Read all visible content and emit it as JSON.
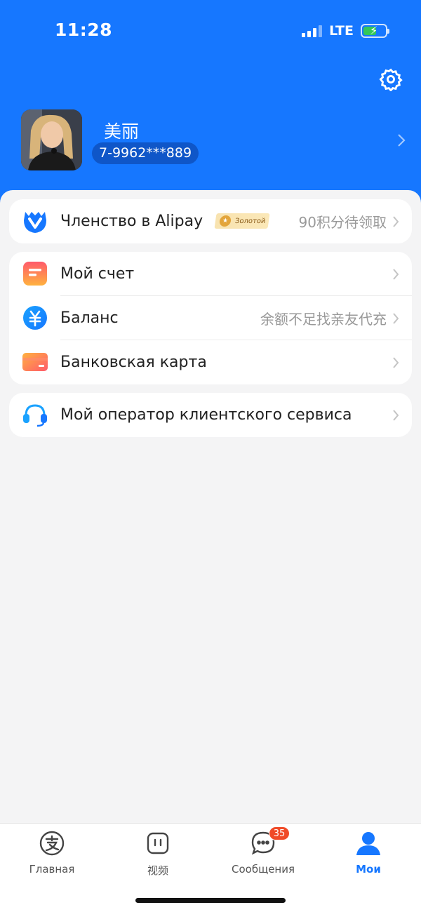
{
  "status_bar": {
    "time": "11:28",
    "network": "LTE"
  },
  "profile": {
    "name": "美丽",
    "phone": "7-9962***889"
  },
  "membership": {
    "label": "Членство в Alipay",
    "badge": "Золотой",
    "value": "90积分待领取"
  },
  "account_card": {
    "items": [
      {
        "label": "Мой счет",
        "value": ""
      },
      {
        "label": "Баланс",
        "value": "余额不足找亲友代充"
      },
      {
        "label": "Банковская карта",
        "value": ""
      }
    ]
  },
  "support": {
    "label": "Мой оператор клиентского сервиса"
  },
  "tabbar": {
    "items": [
      {
        "label": "Главная",
        "icon": "alipay-icon"
      },
      {
        "label": "视频",
        "icon": "video-icon"
      },
      {
        "label": "Сообщения",
        "icon": "chat-icon",
        "badge": "35"
      },
      {
        "label": "Мои",
        "icon": "person-icon",
        "active": true
      }
    ]
  },
  "colors": {
    "accent": "#1677ff",
    "badge": "#f04a28"
  }
}
